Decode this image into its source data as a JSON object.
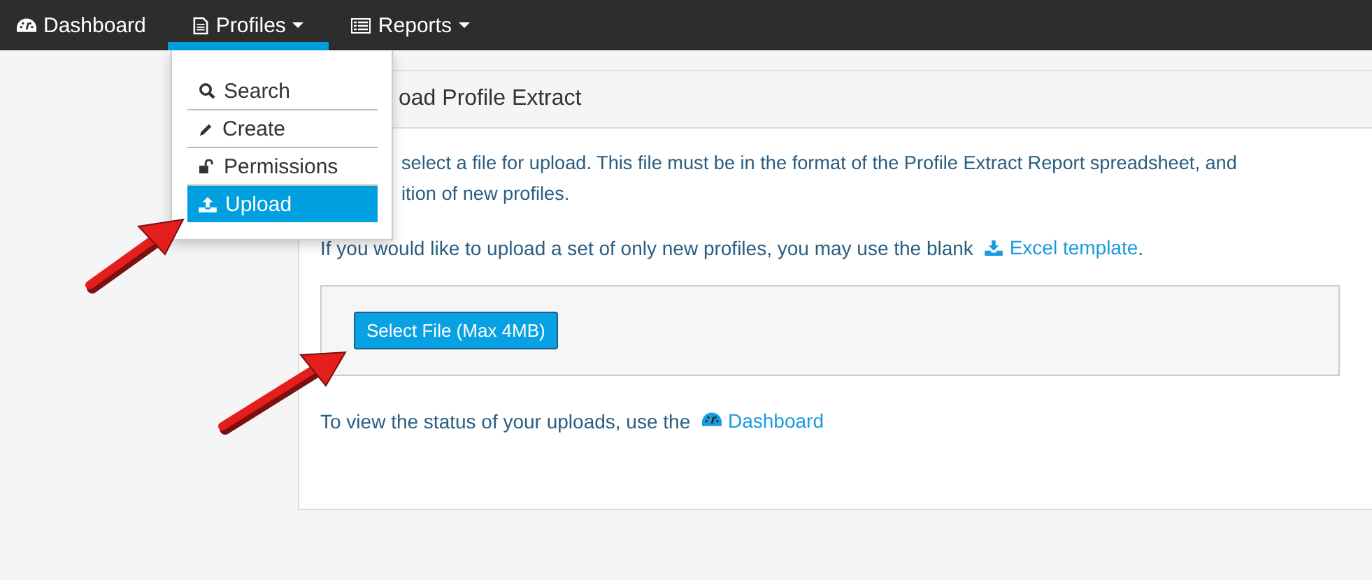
{
  "nav": [
    {
      "label": "Dashboard",
      "kind": "link",
      "selected": false
    },
    {
      "label": "Profiles",
      "kind": "dropdown",
      "selected": true
    },
    {
      "label": "Reports",
      "kind": "dropdown",
      "selected": false
    }
  ],
  "profiles_menu": [
    {
      "label": "Search",
      "selected": false
    },
    {
      "label": "Create",
      "selected": false
    },
    {
      "label": "Permissions",
      "selected": false
    },
    {
      "label": "Upload",
      "selected": true
    }
  ],
  "panel": {
    "title": "oad Profile Extract",
    "intro_lines": [
      "select a file for upload. This file must be in the format of the Profile Extract Report spreadsheet, and",
      "ition of new profiles."
    ],
    "template_note": {
      "text": "If you would like to upload a set of only new profiles, you may use the blank",
      "link": "Excel template",
      "end": "."
    },
    "upload_button": "Select File (Max 4MB)",
    "status_note": {
      "text": "To view the status of your uploads, use the",
      "link": "Dashboard"
    }
  }
}
